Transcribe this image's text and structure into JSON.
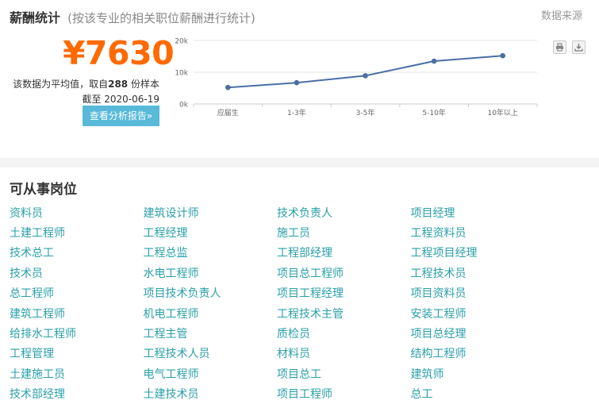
{
  "salary": {
    "title": "薪酬统计",
    "subtitle": "(按该专业的相关职位薪酬进行统计)",
    "source_link": "数据来源",
    "average": "¥7630",
    "note_prefix": "该数据为平均值，取自",
    "sample_count": "288",
    "note_suffix": " 份样本",
    "date": "截至 2020-06-19",
    "report_button": "查看分析报告»"
  },
  "chart_data": {
    "type": "line",
    "categories": [
      "应届生",
      "1-3年",
      "3-5年",
      "5-10年",
      "10年以上"
    ],
    "values": [
      5200,
      6700,
      8900,
      13500,
      15200
    ],
    "yticks": [
      "0k",
      "10k",
      "20k"
    ],
    "ylim": [
      0,
      20000
    ],
    "grid": true,
    "line_color": "#4a6fa5"
  },
  "toolbar": {
    "print_icon": "print-icon",
    "download_icon": "download-icon"
  },
  "jobs": {
    "title": "可从事岗位",
    "rows": [
      [
        "资料员",
        "建筑设计师",
        "技术负责人",
        "项目经理"
      ],
      [
        "土建工程师",
        "工程经理",
        "施工员",
        "工程资料员"
      ],
      [
        "技术总工",
        "工程总监",
        "工程部经理",
        "工程项目经理"
      ],
      [
        "技术员",
        "水电工程师",
        "项目总工程师",
        "工程技术员"
      ],
      [
        "总工程师",
        "项目技术负责人",
        "项目工程经理",
        "项目资料员"
      ],
      [
        "建筑工程师",
        "机电工程师",
        "工程技术主管",
        "安装工程师"
      ],
      [
        "给排水工程师",
        "工程主管",
        "质检员",
        "项目总经理"
      ],
      [
        "工程管理",
        "工程技术人员",
        "材料员",
        "结构工程师"
      ],
      [
        "土建施工员",
        "电气工程师",
        "项目总工",
        "建筑师"
      ],
      [
        "技术部经理",
        "土建技术员",
        "项目工程师",
        "总工"
      ]
    ],
    "link_color": "#2a9fa8"
  }
}
